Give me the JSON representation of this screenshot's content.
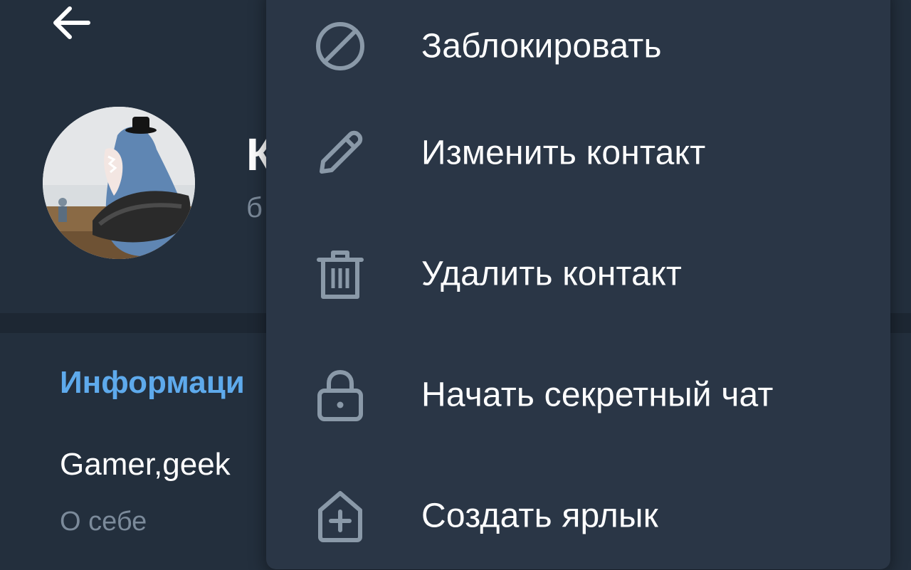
{
  "header": {
    "back_icon": "arrow-left-icon",
    "name_visible": "К",
    "status_visible": "б"
  },
  "info": {
    "section_title": "Информаци",
    "bio_value": "Gamer,geek",
    "bio_label": "О себе"
  },
  "menu": {
    "items": [
      {
        "label": "Заблокировать",
        "icon": "block-icon"
      },
      {
        "label": "Изменить контакт",
        "icon": "pencil-icon"
      },
      {
        "label": "Удалить контакт",
        "icon": "trash-icon"
      },
      {
        "label": "Начать секретный чат",
        "icon": "lock-icon"
      },
      {
        "label": "Создать ярлык",
        "icon": "add-shortcut-icon"
      }
    ]
  },
  "colors": {
    "background": "#1f2936",
    "panel": "#232f3d",
    "menu": "#2a3646",
    "accent": "#5eaaec",
    "icon": "#8a99a8",
    "secondary_text": "#7b8a9a"
  }
}
